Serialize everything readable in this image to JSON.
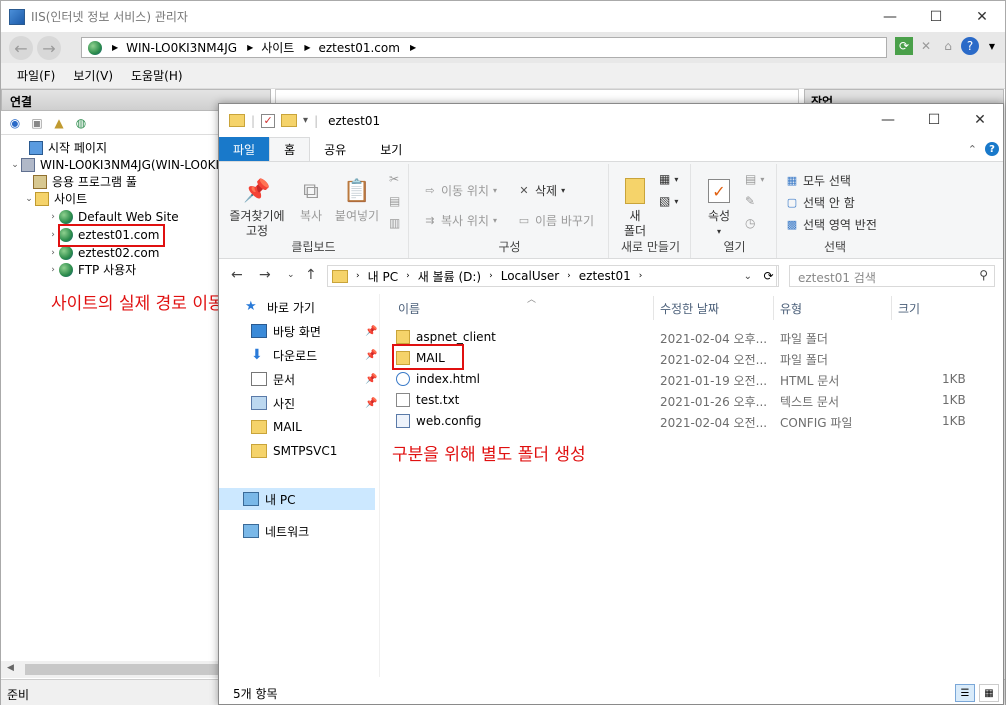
{
  "iis": {
    "title": "IIS(인터넷 정보 서비스) 관리자",
    "window_controls": {
      "minimize": "—",
      "maximize": "☐",
      "close": "✕"
    },
    "address": {
      "segments": [
        "WIN-LO0KI3NM4JG",
        "사이트",
        "eztest01.com"
      ],
      "separator": "▶"
    },
    "menu": [
      "파일(F)",
      "보기(V)",
      "도움말(H)"
    ],
    "connections_header": "연결",
    "actions_header": "작업",
    "tree": [
      {
        "label": "시작 페이지",
        "icon": "start-page-icon"
      },
      {
        "label": "WIN-LO0KI3NM4JG(WIN-LO0KI",
        "icon": "server-icon",
        "twisty": "⌄"
      },
      {
        "label": "응용 프로그램 풀",
        "icon": "app-pool-icon"
      },
      {
        "label": "사이트",
        "icon": "sites-folder-icon",
        "twisty": "⌄"
      },
      {
        "label": "Default Web Site",
        "icon": "globe-icon",
        "twisty": "›"
      },
      {
        "label": "eztest01.com",
        "icon": "globe-icon",
        "twisty": "›"
      },
      {
        "label": "eztest02.com",
        "icon": "globe-icon",
        "twisty": "›"
      },
      {
        "label": "FTP 사용자",
        "icon": "globe-icon",
        "twisty": "›"
      }
    ],
    "annotation_left": "사이트의 실제 경로 이동 후",
    "status": "준비"
  },
  "explorer": {
    "title": "eztest01",
    "window_controls": {
      "minimize": "—",
      "maximize": "☐",
      "close": "✕"
    },
    "tabs": [
      "파일",
      "홈",
      "공유",
      "보기"
    ],
    "ribbon": {
      "clipboard": {
        "label": "클립보드",
        "pin_line1": "즐겨찾기에",
        "pin_line2": "고정",
        "copy": "복사",
        "paste": "붙여넣기"
      },
      "organize": {
        "label": "구성",
        "move_to": "이동 위치",
        "copy_to": "복사 위치",
        "delete": "삭제",
        "rename": "이름 바꾸기"
      },
      "new": {
        "label": "새로 만들기",
        "folder_line1": "새",
        "folder_line2": "폴더"
      },
      "open": {
        "label": "열기",
        "properties": "속성"
      },
      "select": {
        "label": "선택",
        "select_all": "모두 선택",
        "select_none": "선택 안 함",
        "invert": "선택 영역 반전"
      }
    },
    "path": [
      "내 PC",
      "새 볼륨 (D:)",
      "LocalUser",
      "eztest01"
    ],
    "search_placeholder": "eztest01 검색",
    "nav": [
      {
        "label": "바로 가기",
        "icon": "star-icon"
      },
      {
        "label": "바탕 화면",
        "icon": "desktop-icon",
        "pinned": true
      },
      {
        "label": "다운로드",
        "icon": "download-icon",
        "pinned": true
      },
      {
        "label": "문서",
        "icon": "documents-icon",
        "pinned": true
      },
      {
        "label": "사진",
        "icon": "pictures-icon",
        "pinned": true
      },
      {
        "label": "MAIL",
        "icon": "folder-icon"
      },
      {
        "label": "SMTPSVC1",
        "icon": "folder-icon"
      },
      {
        "label": "내 PC",
        "icon": "pc-icon",
        "selected": true
      },
      {
        "label": "네트워크",
        "icon": "network-icon"
      }
    ],
    "columns": [
      "이름",
      "수정한 날짜",
      "유형",
      "크기"
    ],
    "files": [
      {
        "name": "aspnet_client",
        "date": "2021-02-04 오후...",
        "type": "파일 폴더",
        "size": "",
        "kind": "folder"
      },
      {
        "name": "MAIL",
        "date": "2021-02-04 오전...",
        "type": "파일 폴더",
        "size": "",
        "kind": "folder"
      },
      {
        "name": "index.html",
        "date": "2021-01-19 오전...",
        "type": "HTML 문서",
        "size": "1KB",
        "kind": "html"
      },
      {
        "name": "test.txt",
        "date": "2021-01-26 오후...",
        "type": "텍스트 문서",
        "size": "1KB",
        "kind": "txt"
      },
      {
        "name": "web.config",
        "date": "2021-02-04 오전...",
        "type": "CONFIG 파일",
        "size": "1KB",
        "kind": "cfg"
      }
    ],
    "annotation_right": "구분을 위해 별도 폴더 생성",
    "status": "5개 항목"
  },
  "colors": {
    "annotation": "#e01010",
    "file_tab": "#1979ca",
    "selection": "#cce8ff"
  }
}
